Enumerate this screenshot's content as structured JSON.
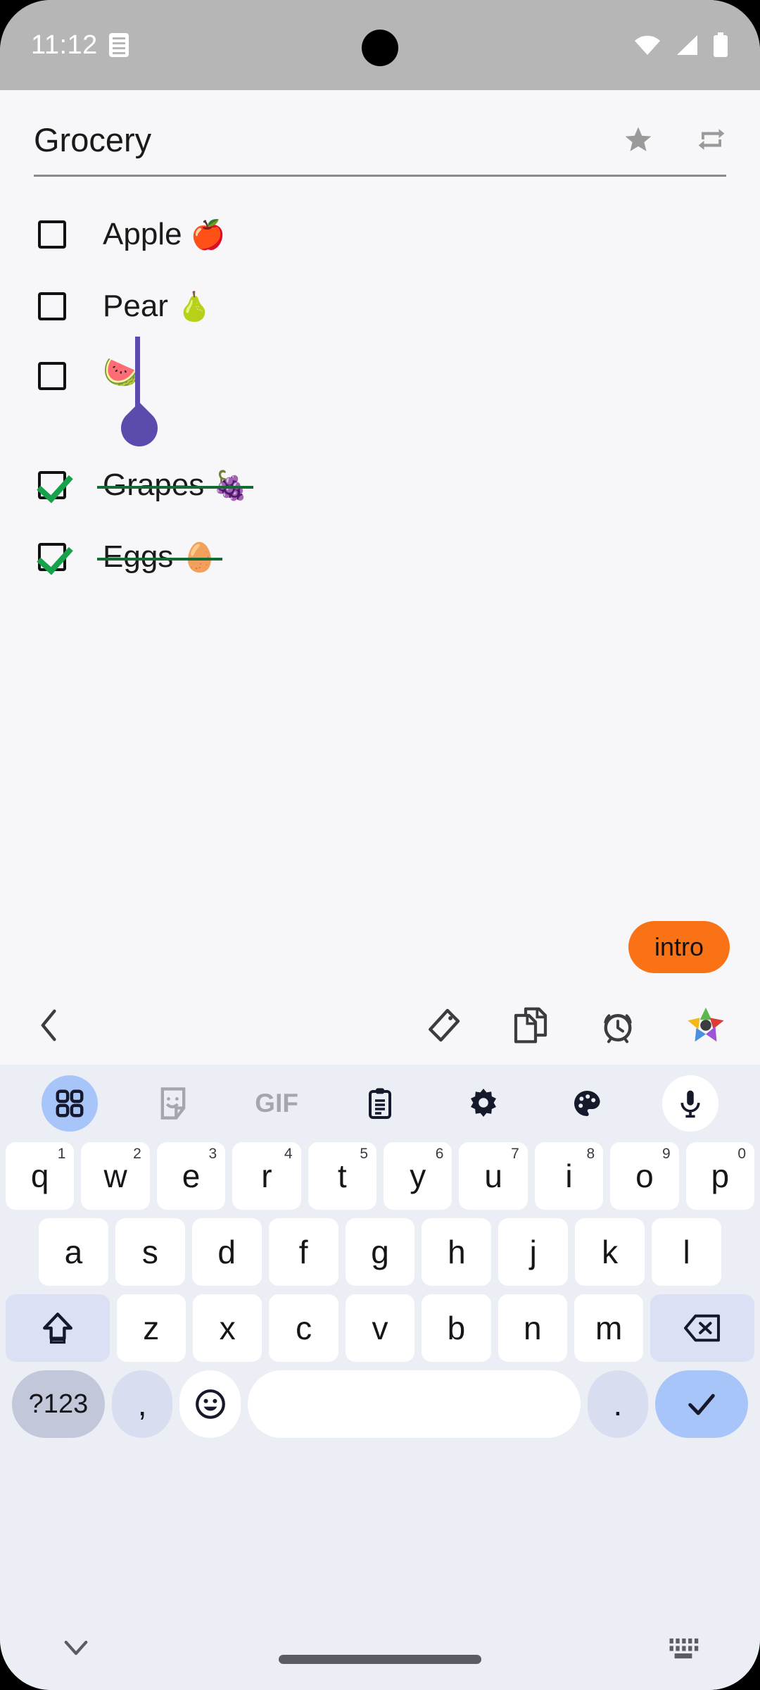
{
  "status_bar": {
    "time": "11:12",
    "notification_icon": "notes-icon",
    "icons": [
      "wifi-icon",
      "cellular-signal-icon",
      "battery-icon"
    ],
    "background_color": "#b6b6b6"
  },
  "note": {
    "title": "Grocery",
    "actions": [
      {
        "name": "favorite-star-icon",
        "label": "star"
      },
      {
        "name": "repeat-icon",
        "label": "repeat"
      }
    ],
    "items": [
      {
        "label": "Apple",
        "emoji": "🍎",
        "checked": false
      },
      {
        "label": "Pear",
        "emoji": "🍐",
        "checked": false
      },
      {
        "label": "",
        "emoji": "🍉",
        "checked": false,
        "editing": true
      },
      {
        "label": "Grapes",
        "emoji": "🍇",
        "checked": true
      },
      {
        "label": "Eggs",
        "emoji": "🥚",
        "checked": true
      }
    ],
    "strikethrough_color": "#156b32",
    "check_color": "#15a24a",
    "caret_color": "#5b4bad"
  },
  "suggestion_chip": {
    "label": "intro",
    "color": "#f97316"
  },
  "app_toolbar": {
    "back": {
      "name": "back-chevron-icon",
      "label": "Back"
    },
    "actions": [
      {
        "name": "tag-icon",
        "label": "Tag"
      },
      {
        "name": "copy-icon",
        "label": "Duplicate"
      },
      {
        "name": "alarm-clock-icon",
        "label": "Reminder"
      },
      {
        "name": "star-app-icon",
        "label": "App"
      }
    ]
  },
  "keyboard": {
    "toolbar": [
      {
        "name": "apps-grid-icon",
        "label": "Apps",
        "active": true
      },
      {
        "name": "sticker-icon",
        "label": "Stickers",
        "active": false
      },
      {
        "name": "gif-icon",
        "label": "GIF",
        "active": false
      },
      {
        "name": "clipboard-icon",
        "label": "Clipboard",
        "active": false
      },
      {
        "name": "settings-gear-icon",
        "label": "Settings",
        "active": false
      },
      {
        "name": "palette-icon",
        "label": "Theme",
        "active": false
      },
      {
        "name": "microphone-icon",
        "label": "Voice input",
        "active": false
      }
    ],
    "row1": [
      {
        "key": "q",
        "num": "1"
      },
      {
        "key": "w",
        "num": "2"
      },
      {
        "key": "e",
        "num": "3"
      },
      {
        "key": "r",
        "num": "4"
      },
      {
        "key": "t",
        "num": "5"
      },
      {
        "key": "y",
        "num": "6"
      },
      {
        "key": "u",
        "num": "7"
      },
      {
        "key": "i",
        "num": "8"
      },
      {
        "key": "o",
        "num": "9"
      },
      {
        "key": "p",
        "num": "0"
      }
    ],
    "row2": [
      "a",
      "s",
      "d",
      "f",
      "g",
      "h",
      "j",
      "k",
      "l"
    ],
    "row3": [
      "z",
      "x",
      "c",
      "v",
      "b",
      "n",
      "m"
    ],
    "shift_key": "shift-key",
    "backspace_key": "backspace-key",
    "row4": {
      "symbols": "?123",
      "comma": ",",
      "emoji": "emoji-key",
      "space": "",
      "period": ".",
      "enter": "enter-key"
    }
  },
  "nav_bar": {
    "hide_keyboard": "chevron-down-icon",
    "home_indicator": "home-indicator",
    "switch_keyboard": "keyboard-switch-icon"
  },
  "colors": {
    "page_background": "#f7f7f9",
    "keyboard_background": "#eceef6",
    "key_face": "#ffffff",
    "modifier_key": "#dbe0f5",
    "accent_blue": "#a8c5fa",
    "accent_orange": "#f97316"
  }
}
